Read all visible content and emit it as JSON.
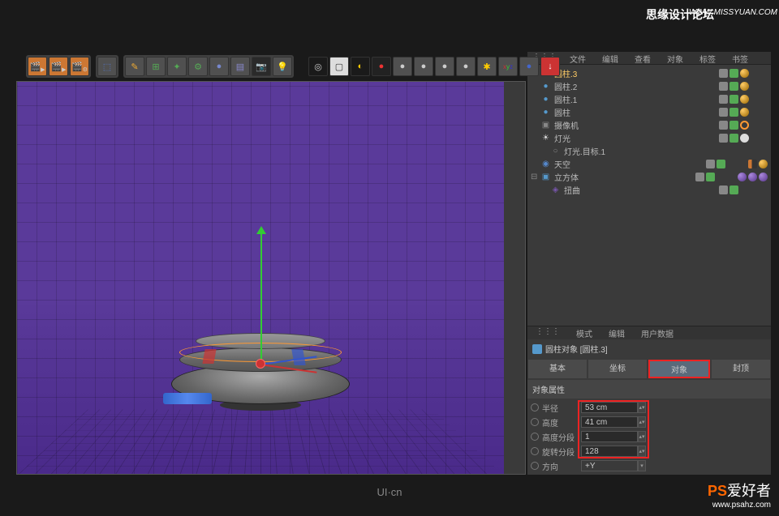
{
  "watermarks": {
    "top_text": "思缘设计论坛",
    "top_url": "WWW.MISSYUAN.COM",
    "bottom_logo_ps": "PS",
    "bottom_logo_text": "爱好者",
    "bottom_url": "www.psahz.com",
    "center_logo": "UI·cn"
  },
  "obj_panel_tabs": {
    "menu": "⋮⋮⋮",
    "file": "文件",
    "edit": "编辑",
    "view": "查看",
    "object": "对象",
    "tag": "标签",
    "bookmark": "书签"
  },
  "objects": [
    {
      "name": "圆柱.3",
      "active": true,
      "icon": "●",
      "iconColor": "#5599cc"
    },
    {
      "name": "圆柱.2",
      "icon": "●",
      "iconColor": "#5599cc"
    },
    {
      "name": "圆柱.1",
      "icon": "●",
      "iconColor": "#5599cc"
    },
    {
      "name": "圆柱",
      "icon": "●",
      "iconColor": "#5599cc"
    },
    {
      "name": "摄像机",
      "icon": "▣",
      "iconColor": "#888"
    },
    {
      "name": "灯光",
      "icon": "☀",
      "iconColor": "#ddd"
    },
    {
      "name": "灯光.目标.1",
      "indent": 12,
      "icon": "○",
      "iconColor": "#888"
    },
    {
      "name": "天空",
      "icon": "◉",
      "iconColor": "#5588cc"
    },
    {
      "name": "立方体",
      "expand": "⊟",
      "icon": "▣",
      "iconColor": "#5599cc"
    },
    {
      "name": "扭曲",
      "indent": 12,
      "icon": "◈",
      "iconColor": "#7755aa"
    }
  ],
  "attr_panel_tabs": {
    "menu": "⋮⋮⋮",
    "mode": "模式",
    "edit": "编辑",
    "userdata": "用户数据"
  },
  "attr_title": "圆柱对象 [圆柱.3]",
  "sub_tabs": {
    "basic": "基本",
    "coord": "坐标",
    "object": "对象",
    "cap": "封顶"
  },
  "section_title": "对象属性",
  "attrs": {
    "radius": {
      "label": "半径",
      "value": "53 cm"
    },
    "height": {
      "label": "高度",
      "value": "41 cm"
    },
    "hseg": {
      "label": "高度分段",
      "value": "1"
    },
    "rseg": {
      "label": "旋转分段",
      "value": "128"
    },
    "dir": {
      "label": "方向",
      "value": "+Y"
    }
  }
}
